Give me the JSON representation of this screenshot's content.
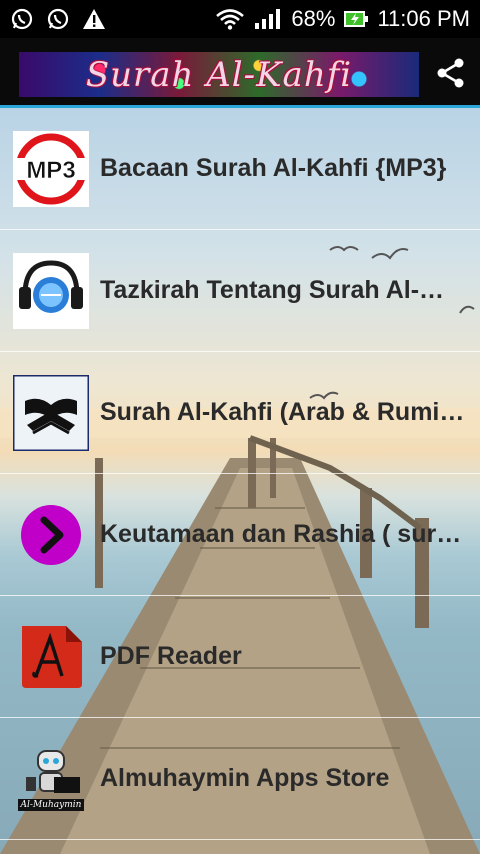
{
  "status_bar": {
    "left_icons": [
      "whatsapp-icon",
      "whatsapp-icon",
      "warning-icon"
    ],
    "battery_percent": "68%",
    "time": "11:06 PM"
  },
  "app_bar": {
    "banner_title": "Surah Al-Kahfi",
    "share_icon": "share-icon"
  },
  "list": {
    "items": [
      {
        "label": "Bacaan Surah Al-Kahfi {MP3}",
        "icon": "mp3-icon"
      },
      {
        "label": "Tazkirah Tentang Surah Al-…",
        "icon": "headphones-icon"
      },
      {
        "label": "Surah Al-Kahfi (Arab & Rumi…",
        "icon": "quran-icon"
      },
      {
        "label": "Keutamaan dan Rashia ( sur…",
        "icon": "chevron-right-icon"
      },
      {
        "label": "PDF Reader",
        "icon": "pdf-icon"
      },
      {
        "label": "Almuhaymin Apps Store",
        "icon": "robot-icon",
        "icon_caption": "Al-Muhaymin"
      }
    ]
  },
  "colors": {
    "accent": "#2aa7d8",
    "text": "#2a2a2a",
    "mp3_red": "#e0141b",
    "chevron_purple": "#c000c8",
    "pdf_red": "#d42a1a"
  }
}
